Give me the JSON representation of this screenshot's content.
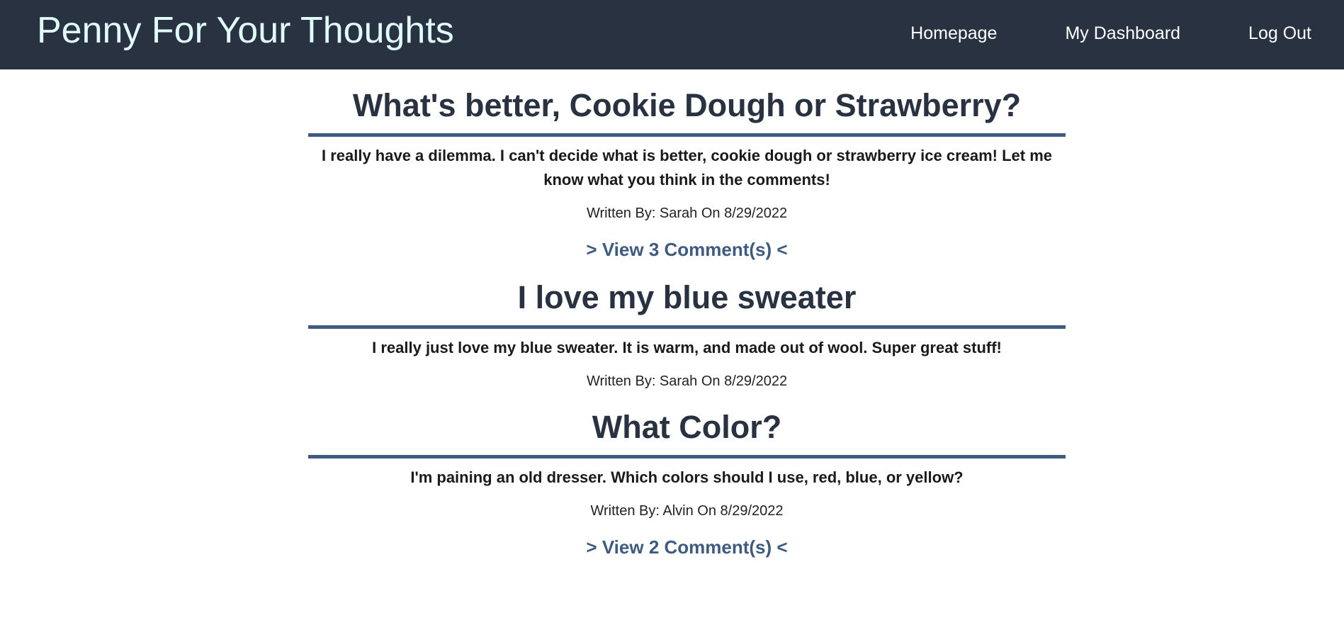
{
  "header": {
    "site_title": "Penny For Your Thoughts",
    "nav": [
      {
        "label": "Homepage"
      },
      {
        "label": "My Dashboard"
      },
      {
        "label": "Log Out"
      }
    ]
  },
  "posts": [
    {
      "title": "What's better, Cookie Dough or Strawberry?",
      "body": "I really have a dilemma. I can't decide what is better, cookie dough or strawberry ice cream! Let me know what you think in the comments!",
      "meta": "Written By: Sarah On 8/29/2022",
      "comments_link": "> View 3 Comment(s) <"
    },
    {
      "title": "I love my blue sweater",
      "body": "I really just love my blue sweater. It is warm, and made out of wool. Super great stuff!",
      "meta": "Written By: Sarah On 8/29/2022"
    },
    {
      "title": "What Color?",
      "body": "I'm paining an old dresser. Which colors should I use, red, blue, or yellow?",
      "meta": "Written By: Alvin On 8/29/2022",
      "comments_link": "> View 2 Comment(s) <"
    }
  ],
  "colors": {
    "navbar_bg": "#293241",
    "title_text": "#e0fbfc",
    "accent": "#3d5a80",
    "heading_text": "#293241"
  }
}
